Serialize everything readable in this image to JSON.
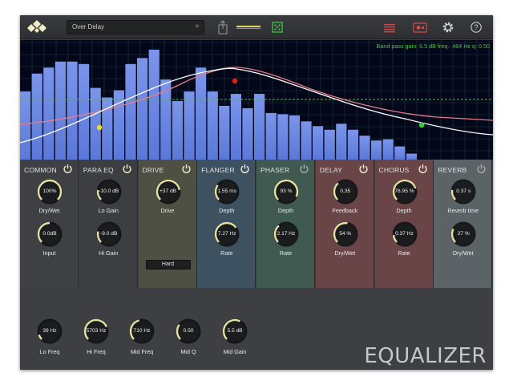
{
  "toolbar": {
    "preset_name": "Over Delay",
    "preset_add": "+",
    "icons": [
      "logo-icon",
      "share-icon",
      "meter-icon",
      "dice-icon",
      "list-icon",
      "record-icon",
      "gear-icon",
      "help-icon"
    ]
  },
  "graph": {
    "info": "Band pass gain:  6.5 dB freq.:  484 Hz q:  0.50",
    "bars": [
      0.57,
      0.72,
      0.77,
      0.82,
      0.82,
      0.8,
      0.6,
      0.52,
      0.58,
      0.8,
      0.85,
      0.92,
      0.67,
      0.49,
      0.57,
      0.77,
      0.57,
      0.45,
      0.55,
      0.43,
      0.55,
      0.39,
      0.38,
      0.37,
      0.32,
      0.28,
      0.25,
      0.3,
      0.25,
      0.2,
      0.16,
      0.17,
      0.11,
      0.05
    ],
    "colors": {
      "bar": "#5a78d8",
      "bar_top": "#7b95ea",
      "grid": "#173c3a",
      "curve_white": "#ffffff",
      "curve_pink": "#e77b8a",
      "ref_line": "#4fb748",
      "info": "#46c83c"
    },
    "handles": [
      {
        "name": "low-shelf-handle",
        "color": "#e7e01a"
      },
      {
        "name": "band-pass-handle",
        "color": "#e02020"
      },
      {
        "name": "high-shelf-handle",
        "color": "#2fd02f"
      }
    ]
  },
  "modules": [
    {
      "id": "common",
      "title": "COMMON",
      "bg": "#3f4044",
      "power_on": true,
      "knobs": [
        {
          "value": "100%",
          "label": "Dry/Wet",
          "level": 1.0
        },
        {
          "value": "0.0dB",
          "label": "Input",
          "level": 0.5
        }
      ]
    },
    {
      "id": "paraeq",
      "title": "PARA EQ",
      "bg": "#3d3e42",
      "power_on": true,
      "knobs": [
        {
          "value": "-10.0 dB",
          "label": "Lo Gain",
          "level": 0.2
        },
        {
          "value": "-9.0 dB",
          "label": "Hi Gain",
          "level": 0.22
        }
      ]
    },
    {
      "id": "drive",
      "title": "DRIVE",
      "bg": "#4d5043",
      "power_on": true,
      "knobs": [
        {
          "value": "+37 dB",
          "label": "Drive",
          "level": 0.8
        }
      ],
      "mode": "Hard"
    },
    {
      "id": "flanger",
      "title": "FLANGER",
      "bg": "#3e5160",
      "power_on": true,
      "knobs": [
        {
          "value": "1.55  ms",
          "label": "Depth",
          "level": 0.3
        },
        {
          "value": "7.27 Hz",
          "label": "Rate",
          "level": 0.7
        }
      ]
    },
    {
      "id": "phaser",
      "title": "PHASER",
      "bg": "#405a52",
      "power_on": false,
      "knobs": [
        {
          "value": "93 %",
          "label": "Depth",
          "level": 0.93
        },
        {
          "value": "2.17 Hz",
          "label": "Rate",
          "level": 0.35
        }
      ]
    },
    {
      "id": "delay",
      "title": "DELAY",
      "bg": "#6a4548",
      "power_on": true,
      "knobs": [
        {
          "value": "0.35",
          "label": "Feedback",
          "level": 0.35
        },
        {
          "value": "54  %",
          "label": "Dry/Wet",
          "level": 0.54
        }
      ]
    },
    {
      "id": "chorus",
      "title": "CHORUS",
      "bg": "#6a4548",
      "power_on": true,
      "knobs": [
        {
          "value": "76.95 %",
          "label": "Depth",
          "level": 0.77
        },
        {
          "value": "0.37 Hz",
          "label": "Rate",
          "level": 0.15
        }
      ]
    },
    {
      "id": "reverb",
      "title": "REVERB",
      "bg": "#5b6367",
      "power_on": false,
      "knobs": [
        {
          "value": "0.37 s",
          "label": "Reverb time",
          "level": 0.2
        },
        {
          "value": "27 %",
          "label": "Dry/Wet",
          "level": 0.27
        }
      ]
    }
  ],
  "bottom_knobs": [
    {
      "value": "39 Hz",
      "label": "Lo Freq",
      "level": 0.1
    },
    {
      "value": "5703 Hz",
      "label": "Hi Freq",
      "level": 0.75
    },
    {
      "value": "710 Hz",
      "label": "Mid Freq",
      "level": 0.45
    },
    {
      "value": "0.50",
      "label": "Mid Q",
      "level": 0.3
    },
    {
      "value": "5.5 dB",
      "label": "Mid Gain",
      "level": 0.6
    }
  ],
  "brand": "EQUALIZER",
  "accent": "#e6e0a0"
}
